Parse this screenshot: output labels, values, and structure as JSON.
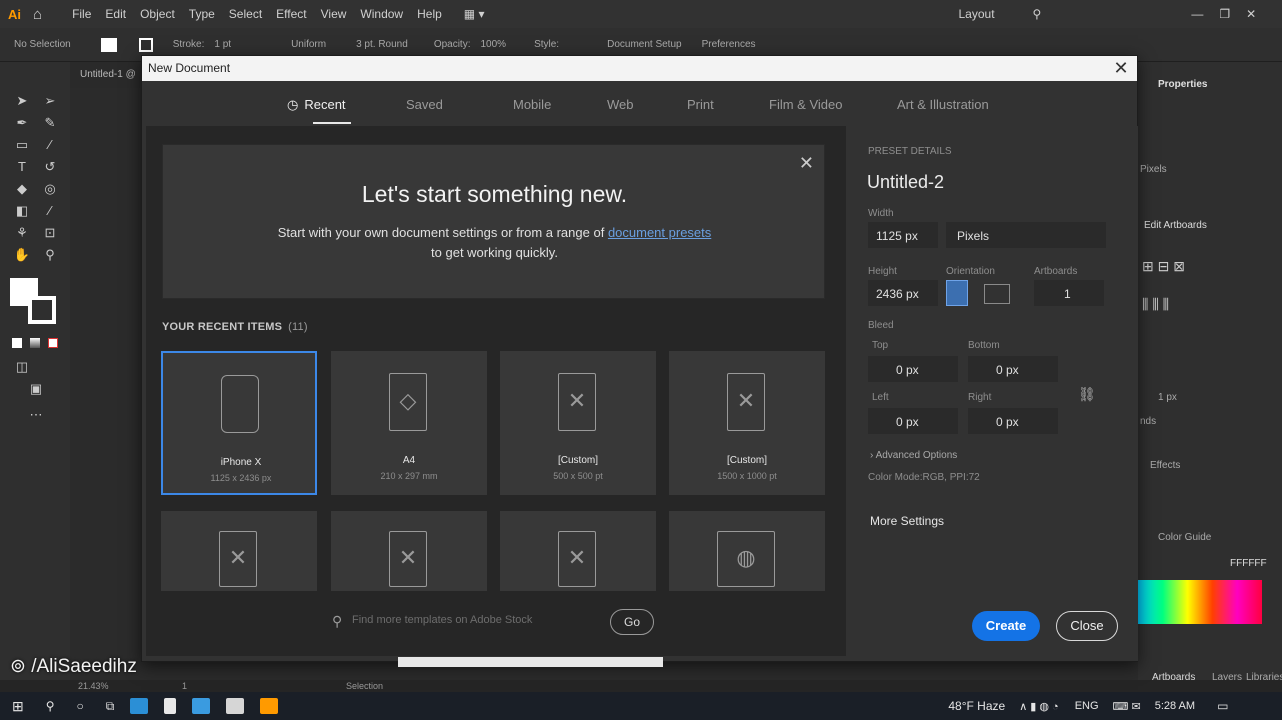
{
  "menubar": {
    "items": [
      "File",
      "Edit",
      "Object",
      "Type",
      "Select",
      "Effect",
      "View",
      "Window",
      "Help"
    ],
    "layout_label": "Layout"
  },
  "ctrlbar": {
    "no_selection": "No Selection",
    "stroke_label": "Stroke:",
    "stroke_value": "1 pt",
    "profile": "Uniform",
    "brush": "3 pt. Round",
    "opacity_label": "Opacity:",
    "opacity_value": "100%",
    "style_label": "Style:",
    "doc_setup": "Document Setup",
    "preferences": "Preferences"
  },
  "doc_tab": "Untitled-1 @",
  "dialog": {
    "title": "New Document",
    "tabs": [
      "Recent",
      "Saved",
      "Mobile",
      "Web",
      "Print",
      "Film & Video",
      "Art & Illustration"
    ],
    "active_tab": "Recent",
    "welcome": {
      "heading": "Let's start something new.",
      "line1_pre": "Start with your own document settings or from a range of",
      "line1_link": "document presets",
      "line2": "to get working quickly."
    },
    "recent_head": "YOUR RECENT ITEMS",
    "recent_count": "(11)",
    "recent_items": [
      {
        "name": "iPhone X",
        "dims": "1125 x 2436 px"
      },
      {
        "name": "A4",
        "dims": "210 x 297 mm"
      },
      {
        "name": "[Custom]",
        "dims": "500 x 500 pt"
      },
      {
        "name": "[Custom]",
        "dims": "1500 x 1000 pt"
      }
    ],
    "search_placeholder": "Find more templates on Adobe Stock",
    "go_label": "Go",
    "preset": {
      "section": "PRESET DETAILS",
      "doc_name": "Untitled-2",
      "width_label": "Width",
      "width_value": "1125 px",
      "units": "Pixels",
      "height_label": "Height",
      "height_value": "2436 px",
      "orientation_label": "Orientation",
      "artboards_label": "Artboards",
      "artboards_value": "1",
      "bleed_label": "Bleed",
      "top_label": "Top",
      "top_value": "0 px",
      "bottom_label": "Bottom",
      "bottom_value": "0 px",
      "left_label": "Left",
      "left_value": "0 px",
      "right_label": "Right",
      "right_value": "0 px",
      "advanced": "Advanced Options",
      "color_mode": "Color Mode:RGB, PPI:72",
      "more_settings": "More Settings"
    },
    "create_label": "Create",
    "close_label": "Close"
  },
  "right_panel": {
    "title": "Properties",
    "units": "Pixels",
    "edit_artboards": "Edit Artboards",
    "pt_value": "1 px",
    "ends": "nds",
    "effects": "Effects",
    "color_guide": "Color Guide",
    "hex": "FFFFFF",
    "tabs": [
      "Artboards",
      "Layers",
      "Libraries"
    ]
  },
  "statusbar": {
    "zoom": "21.43%",
    "artboard": "1",
    "state": "Selection"
  },
  "taskbar": {
    "weather": "48°F Haze",
    "lang": "ENG",
    "time": "5:28 AM"
  },
  "watermark": "/AliSaeedihz",
  "colors": {
    "accent": "#1473e6",
    "selection": "#3c88e8",
    "link": "#6a9fe0",
    "dialog_bg": "#323232",
    "title_bar": "#f3f3f3"
  }
}
